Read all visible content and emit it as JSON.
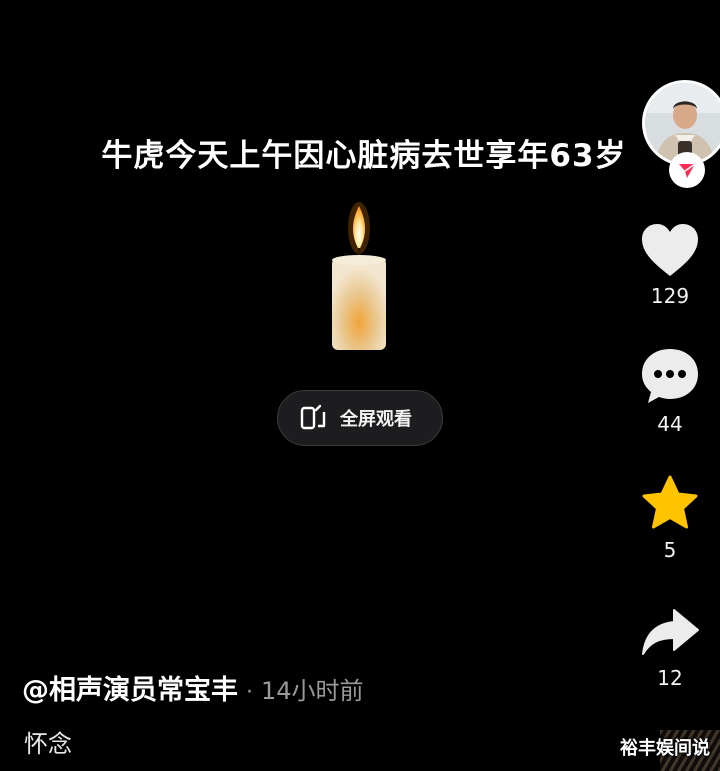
{
  "video": {
    "title": "牛虎今天上午因心脏病去世享年63岁",
    "fullscreen_label": "全屏观看"
  },
  "sidebar": {
    "avatar_icon": "user-avatar",
    "follow_icon": "follow-arrow-icon",
    "like": {
      "icon": "heart-icon",
      "count": "129"
    },
    "comment": {
      "icon": "comment-bubble-icon",
      "count": "44"
    },
    "favorite": {
      "icon": "star-icon",
      "count": "5",
      "color": "#ffc300"
    },
    "share": {
      "icon": "share-arrow-icon",
      "count": "12"
    }
  },
  "post": {
    "author": "@相声演员常宝丰",
    "separator": "·",
    "time": "14小时前",
    "caption": "怀念"
  },
  "watermark": "裕丰娱间说",
  "colors": {
    "background": "#000000",
    "accent_red": "#fe2c55",
    "star": "#ffc300"
  }
}
